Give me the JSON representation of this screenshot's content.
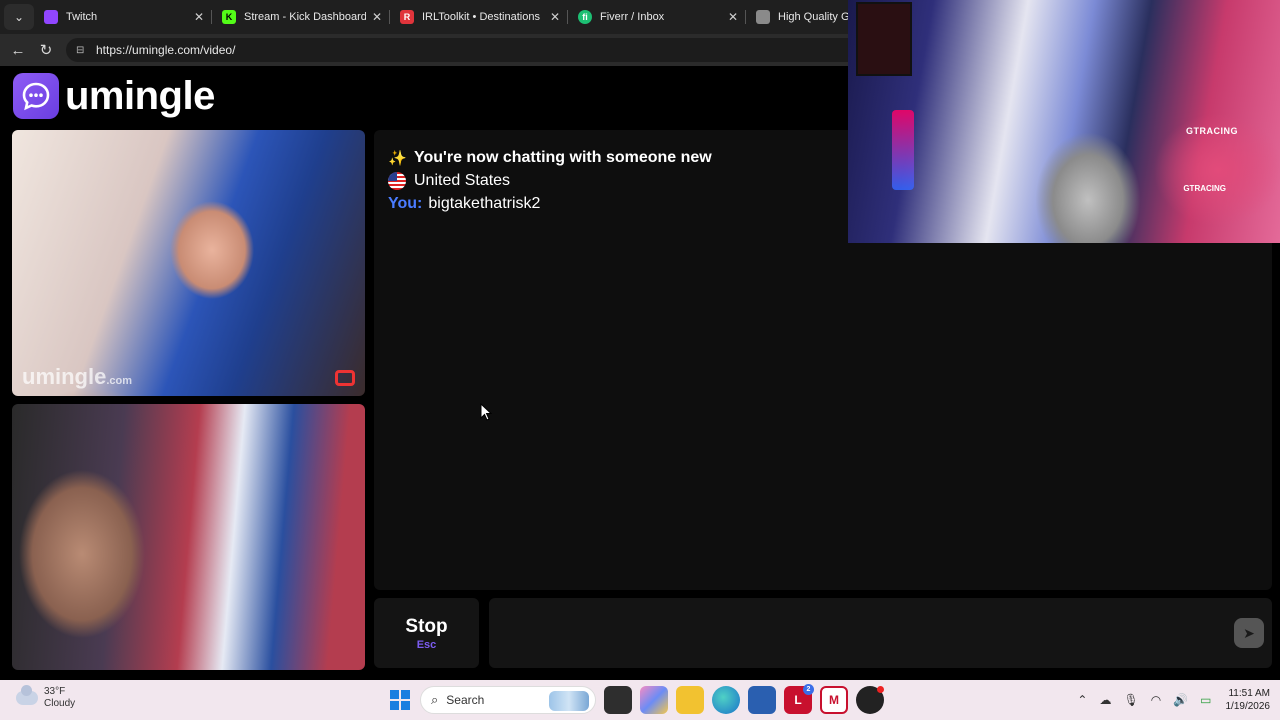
{
  "browser": {
    "tabs": [
      {
        "title": "Twitch",
        "favicon": "twitch-icon",
        "color": "#9146ff"
      },
      {
        "title": "Stream - Kick Dashboard",
        "favicon": "kick-icon",
        "color": "#53fc18"
      },
      {
        "title": "IRLToolkit • Destinations",
        "favicon": "irltoolkit-icon",
        "color": "#e0343b"
      },
      {
        "title": "Fiverr / Inbox",
        "favicon": "fiverr-icon",
        "color": "#1dbf73"
      },
      {
        "title": "High Quality Gam",
        "favicon": "page-icon",
        "color": "#8a8a8a"
      }
    ],
    "url": "https://umingle.com/video/"
  },
  "site": {
    "logo_text": "umingle",
    "brand_color": "#7b4dee",
    "watermark_main": "umingle",
    "watermark_suffix": ".com"
  },
  "chat": {
    "new_chat_message": "You're now chatting with someone new",
    "country": "United States",
    "you_label": "You:",
    "you_message": "bigtakethatrisk2"
  },
  "controls": {
    "stop_label": "Stop",
    "stop_shortcut": "Esc",
    "send_icon": "send-icon"
  },
  "webcam": {
    "chair_brand": "GTRACING"
  },
  "taskbar": {
    "temperature": "33°F",
    "condition": "Cloudy",
    "search_placeholder": "Search",
    "time": "11:51 AM",
    "date": "1/19/2026",
    "mail_badge": "2"
  }
}
